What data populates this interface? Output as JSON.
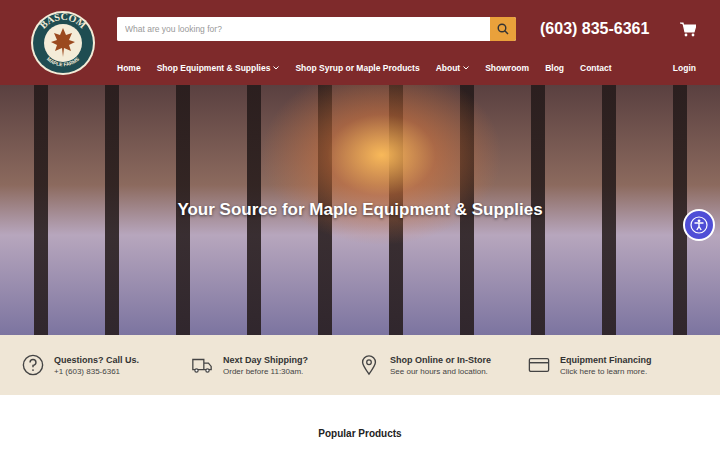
{
  "logo": {
    "title": "BASCOM",
    "subtitle": "MAPLE FARMS"
  },
  "search": {
    "placeholder": "What are you looking for?"
  },
  "phone": "(603) 835-6361",
  "nav": [
    {
      "label": "Home",
      "dropdown": false
    },
    {
      "label": "Shop Equipment & Supplies",
      "dropdown": true
    },
    {
      "label": "Shop Syrup or Maple Products",
      "dropdown": false
    },
    {
      "label": "About",
      "dropdown": true
    },
    {
      "label": "Showroom",
      "dropdown": false
    },
    {
      "label": "Blog",
      "dropdown": false
    },
    {
      "label": "Contact",
      "dropdown": false
    }
  ],
  "login": "Login",
  "hero": {
    "heading": "Your Source for Maple Equipment & Supplies"
  },
  "features": [
    {
      "kind": "question",
      "title": "Questions? Call Us.",
      "text": "+1 (603) 835-6361"
    },
    {
      "kind": "truck",
      "title": "Next Day Shipping?",
      "text": "Order before 11:30am."
    },
    {
      "kind": "pin",
      "title": "Shop Online or In-Store",
      "text": "See our hours and location."
    },
    {
      "kind": "card",
      "title": "Equipment Financing",
      "text": "Click here to learn more."
    }
  ],
  "section": {
    "title": "Popular Products"
  }
}
